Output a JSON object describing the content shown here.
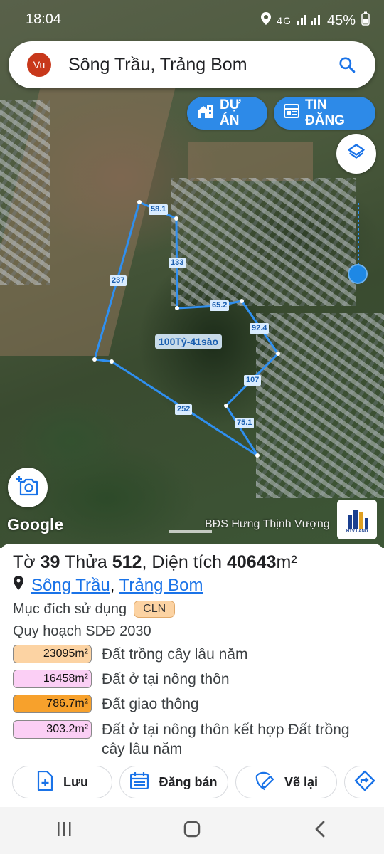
{
  "status": {
    "time": "18:04",
    "network": "4G",
    "battery": "45%"
  },
  "search": {
    "avatar_initials": "Vu",
    "query": "Sông Trầu, Trảng Bom"
  },
  "chips": {
    "du_an": "DỰ ÁN",
    "tin_dang": "TIN ĐĂNG"
  },
  "map": {
    "parcel_edges": [
      "58.1",
      "133",
      "237",
      "65.2",
      "92.4",
      "107",
      "252",
      "75.1"
    ],
    "area_label": "100Tỷ-41sào",
    "google_logo": "Google",
    "watermark": "BĐS Hưng Thịnh Vượng",
    "logo_text": "HTV LAND"
  },
  "parcel": {
    "to_label": "Tờ",
    "to_value": "39",
    "thua_label": "Thửa",
    "thua_value": "512",
    "area_label": ", Diện tích",
    "area_value": "40643",
    "area_unit": "m²",
    "ward": "Sông Trầu",
    "separator": ",",
    "district": "Trảng Bom",
    "purpose_label": "Mục đích sử dụng",
    "purpose_code": "CLN",
    "plan_title": "Quy hoạch SDĐ 2030",
    "plan": [
      {
        "value": "23095m²",
        "label": "Đất trồng cây lâu năm",
        "color": "#fcd3a3"
      },
      {
        "value": "16458m²",
        "label": "Đất ở tại nông thôn",
        "color": "#fbcff5"
      },
      {
        "value": "786.7m²",
        "label": "Đất giao thông",
        "color": "#f7a12c"
      },
      {
        "value": "303.2m²",
        "label": "Đất ở tại nông thôn kết hợp Đất trồng cây lâu năm",
        "color": "#fbcff5"
      }
    ]
  },
  "actions": {
    "save": "Lưu",
    "sell": "Đăng bán",
    "redraw": "Vẽ lại"
  },
  "colors": {
    "accent": "#2d8ae8",
    "link": "#1a73e8",
    "parcel_line": "#2f8ff0"
  }
}
